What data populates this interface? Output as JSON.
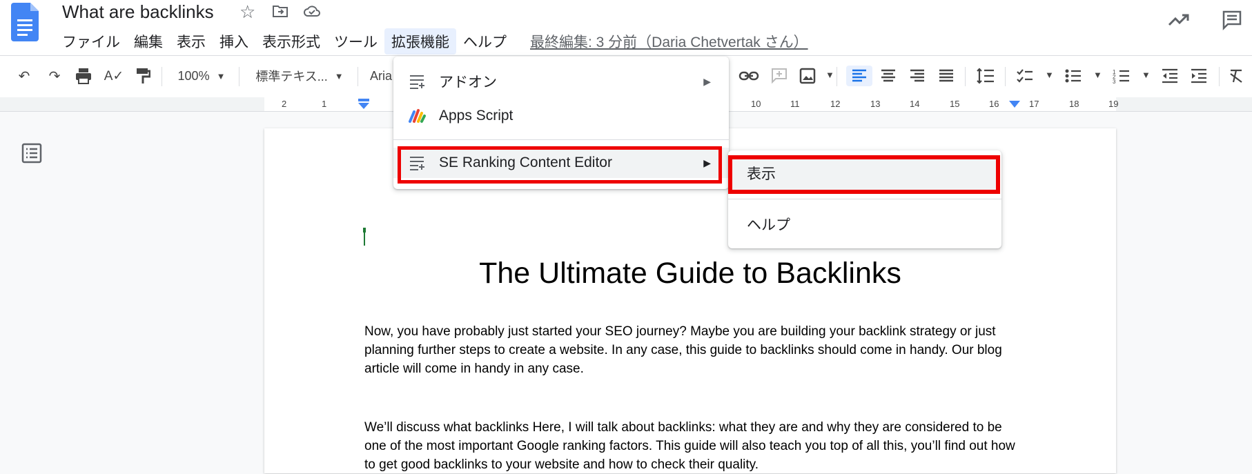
{
  "header": {
    "title": "What are backlinks",
    "menu": [
      "ファイル",
      "編集",
      "表示",
      "挿入",
      "表示形式",
      "ツール",
      "拡張機能",
      "ヘルプ"
    ],
    "last_edit": "最終編集: 3 分前（Daria Chetvertak さん）"
  },
  "toolbar": {
    "zoom": "100%",
    "style": "標準テキス...",
    "font": "Aria"
  },
  "ruler": {
    "numbers": [
      "2",
      "1",
      "10",
      "11",
      "12",
      "13",
      "14",
      "15",
      "16",
      "17",
      "18",
      "19"
    ]
  },
  "extensions_menu": {
    "items": [
      {
        "label": "アドオン",
        "icon": "addon-icon",
        "has_submenu": true
      },
      {
        "label": "Apps Script",
        "icon": "apps-script-icon",
        "has_submenu": false
      },
      {
        "label": "SE Ranking Content Editor",
        "icon": "addon-icon",
        "has_submenu": true
      }
    ]
  },
  "submenu": {
    "items": [
      "表示",
      "ヘルプ"
    ]
  },
  "document": {
    "heading": "The Ultimate Guide to Backlinks",
    "paragraphs": [
      "Now, you have probably just started your SEO journey? Maybe you are building your backlink strategy or just planning further steps to create a website. In any case, this guide to backlinks should come in handy. Our blog article will come in handy in any case.",
      "We’ll discuss what backlinks Here, I will talk about backlinks: what they are and why they are considered to be one of the most important Google ranking factors. This guide will also teach you top of all this, you’ll find out how to get good backlinks to your website and how to check their quality."
    ]
  },
  "colors": {
    "highlight": "#ee0000",
    "doc_blue": "#4285f4",
    "menu_active": "#e8f0fe"
  }
}
